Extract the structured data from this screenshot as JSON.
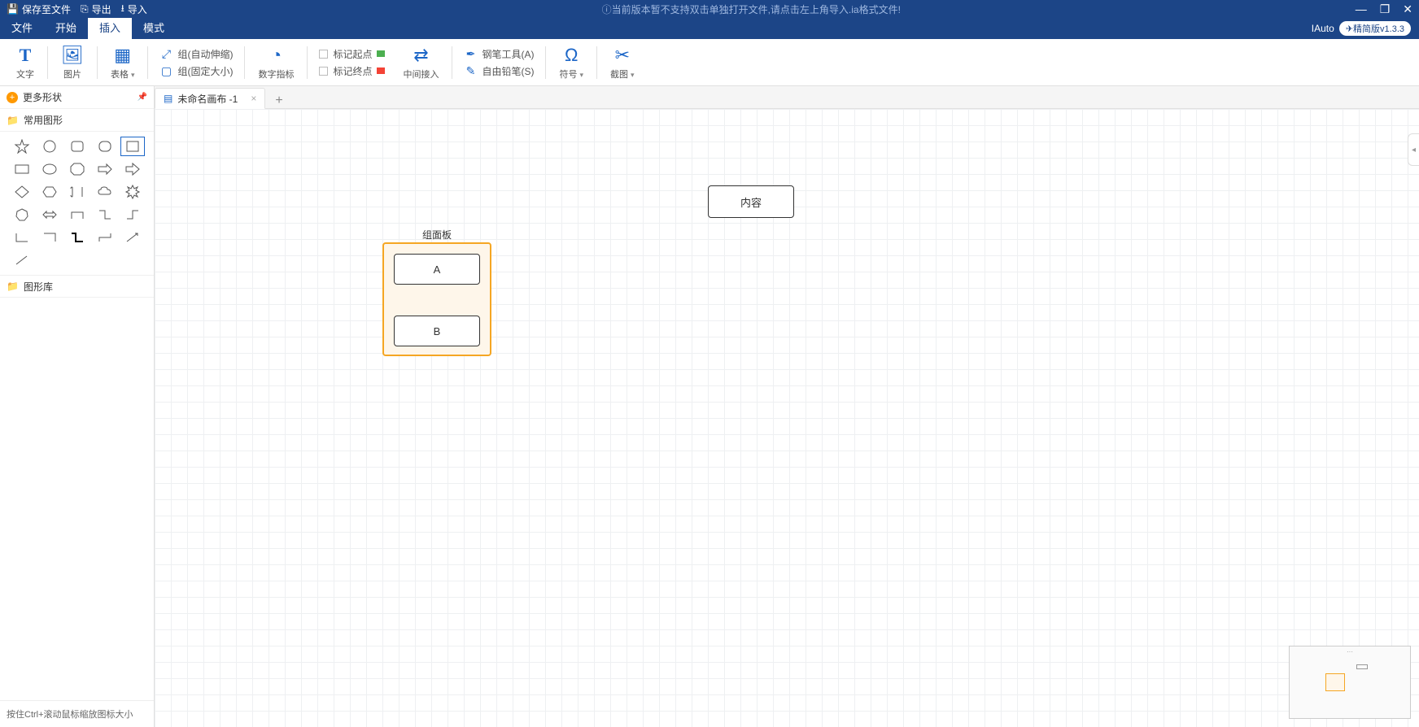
{
  "titlebar": {
    "save": "保存至文件",
    "export": "导出",
    "import": "导入",
    "notice": "ⓘ当前版本暂不支持双击单独打开文件,请点击左上角导入.ia格式文件!"
  },
  "menubar": {
    "items": [
      "文件",
      "开始",
      "插入",
      "模式"
    ],
    "active": 2,
    "brand": "IAuto",
    "version": "精简版v1.3.3"
  },
  "ribbon": {
    "text": {
      "label": "文字"
    },
    "image": {
      "label": "图片"
    },
    "table": {
      "label": "表格"
    },
    "group_auto": "组(自动伸缩)",
    "group_fixed": "组(固定大小)",
    "num_indicator": "数字指标",
    "mark_start": "标记起点",
    "mark_end": "标记终点",
    "mid_insert": "中间接入",
    "pen": "钢笔工具(A)",
    "pencil": "自由铅笔(S)",
    "symbol": "符号",
    "screenshot": "截图"
  },
  "sidebar": {
    "more_shapes": "更多形状",
    "common_shapes": "常用图形",
    "shape_lib": "图形库",
    "tip": "按住Ctrl+滚动鼠标缩放图标大小"
  },
  "tabs": {
    "items": [
      {
        "name": "未命名画布 -1"
      }
    ]
  },
  "canvas": {
    "content_box": "内容",
    "group_title": "组面板",
    "box_a": "A",
    "box_b": "B"
  }
}
